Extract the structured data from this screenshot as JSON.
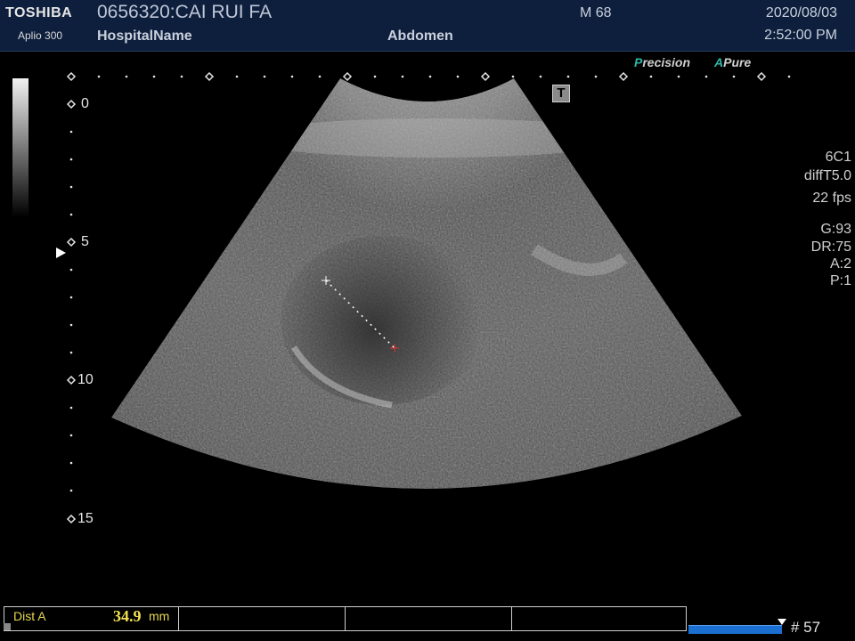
{
  "header": {
    "brand": "TOSHIBA",
    "model": "Aplio 300",
    "patient": "0656320:CAI RUI FA",
    "hospital": "HospitalName",
    "exam": "Abdomen",
    "sex_age": "M 68",
    "date": "2020/08/03",
    "time": "2:52:00 PM"
  },
  "processing": {
    "precision_letter": "P",
    "precision_rest": "recision",
    "apure_letter": "A",
    "apure_rest": "Pure"
  },
  "icons": {
    "t_mark": "T"
  },
  "depth_labels": [
    "0",
    "5",
    "10",
    "15"
  ],
  "right_info": {
    "probe": "6C1",
    "mode": "diffT5.0",
    "fps": "22 fps",
    "gain": "G:93",
    "dynamic_range": "DR:75",
    "a": "A:2",
    "p": "P:1"
  },
  "measurement": {
    "label": "Dist A",
    "value": "34.9",
    "unit": "mm"
  },
  "frame": {
    "number": "# 57"
  },
  "colors": {
    "header_bg": "#0e1f3d",
    "accent_teal": "#2fb6a6",
    "measure_yellow": "#f0e050",
    "cine_blue": "#1b6fd1"
  }
}
